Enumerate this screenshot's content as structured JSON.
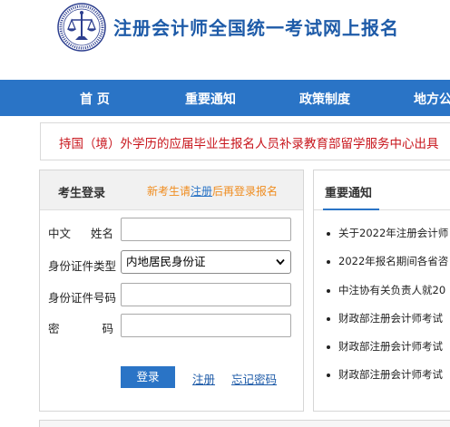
{
  "header": {
    "site_title": "注册会计师全国统一考试网上报名",
    "logo_icon": "cicpa-logo-icon"
  },
  "nav": {
    "items": [
      {
        "label": "首 页"
      },
      {
        "label": "重要通知"
      },
      {
        "label": "政策制度"
      },
      {
        "label": "地方公"
      }
    ]
  },
  "marquee": {
    "text": "持国（境）外学历的应届毕业生报名人员补录教育部留学服务中心出具"
  },
  "login": {
    "title": "考生登录",
    "hint_prefix": "新考生请",
    "hint_link": "注册",
    "hint_suffix": "后再登录报名",
    "name_label_a": "中文",
    "name_label_b": "姓名",
    "id_type_label": "身份证件类型",
    "id_type_value": "内地居民身份证",
    "id_number_label": "身份证件号码",
    "password_label_a": "密",
    "password_label_b": "码",
    "login_button": "登录",
    "register_link": "注册",
    "forgot_link": "忘记密码"
  },
  "notices": {
    "title": "重要通知",
    "items": [
      {
        "text": "关于2022年注册会计师"
      },
      {
        "text": "2022年报名期间各省咨"
      },
      {
        "text": "中注协有关负责人就20"
      },
      {
        "text": "财政部注册会计师考试"
      },
      {
        "text": "财政部注册会计师考试"
      },
      {
        "text": "财政部注册会计师考试"
      }
    ]
  },
  "colors": {
    "brand_blue": "#2a74c6",
    "title_blue": "#1e5ba8",
    "marquee_red": "#c8161d",
    "hint_orange": "#f08c1e"
  }
}
